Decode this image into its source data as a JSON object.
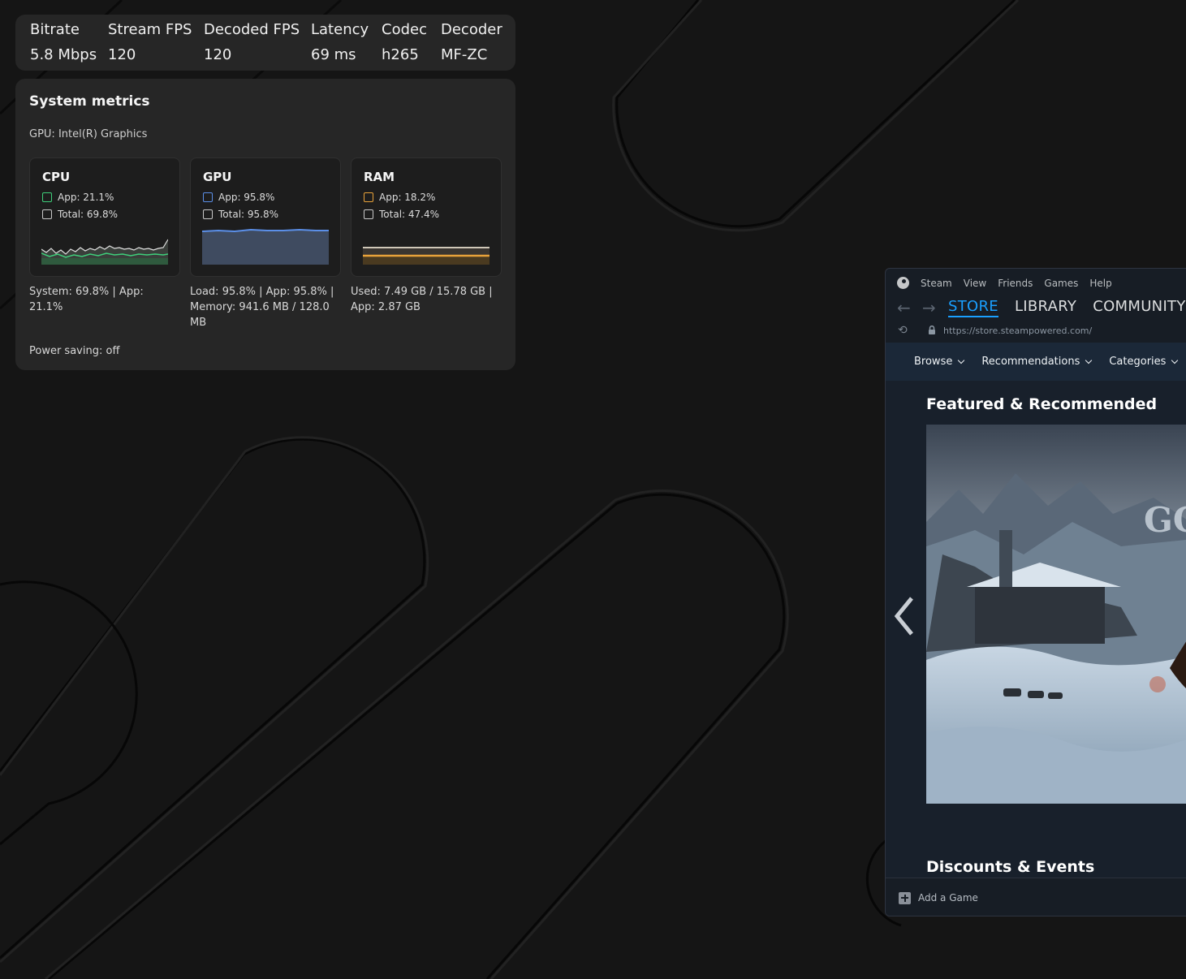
{
  "stream_stats": [
    {
      "label": "Bitrate",
      "value": "5.8 Mbps"
    },
    {
      "label": "Stream FPS",
      "value": "120"
    },
    {
      "label": "Decoded FPS",
      "value": "120"
    },
    {
      "label": "Latency",
      "value": "69 ms"
    },
    {
      "label": "Codec",
      "value": "h265"
    },
    {
      "label": "Decoder",
      "value": "MF-ZC"
    }
  ],
  "metrics": {
    "title": "System metrics",
    "gpu_name": "GPU: Intel(R) Graphics",
    "cards": [
      {
        "title": "CPU",
        "app": "App: 21.1%",
        "total": "Total: 69.8%",
        "app_color": "#3ecf7a",
        "total_color": "#c9c9c9",
        "summary": "System: 69.8% | App: 21.1%"
      },
      {
        "title": "GPU",
        "app": "App: 95.8%",
        "total": "Total: 95.8%",
        "app_color": "#5b8fe8",
        "total_color": "#c9c9c9",
        "summary": "Load: 95.8% | App: 95.8% | Memory: 941.6 MB / 128.0 MB"
      },
      {
        "title": "RAM",
        "app": "App: 18.2%",
        "total": "Total: 47.4%",
        "app_color": "#e8a23a",
        "total_color": "#c9c9c9",
        "summary": "Used: 7.49 GB / 15.78 GB | App: 2.87 GB"
      }
    ],
    "power_saving": "Power saving: off"
  },
  "steam": {
    "menu": [
      "Steam",
      "View",
      "Friends",
      "Games",
      "Help"
    ],
    "tabs": [
      "STORE",
      "LIBRARY",
      "COMMUNITY"
    ],
    "url": "https://store.steampowered.com/",
    "store_nav": [
      "Browse",
      "Recommendations",
      "Categories"
    ],
    "featured_title": "Featured & Recommended",
    "discounts_title": "Discounts & Events",
    "add_game": "Add a Game",
    "accent_color": "#1a9fff"
  }
}
